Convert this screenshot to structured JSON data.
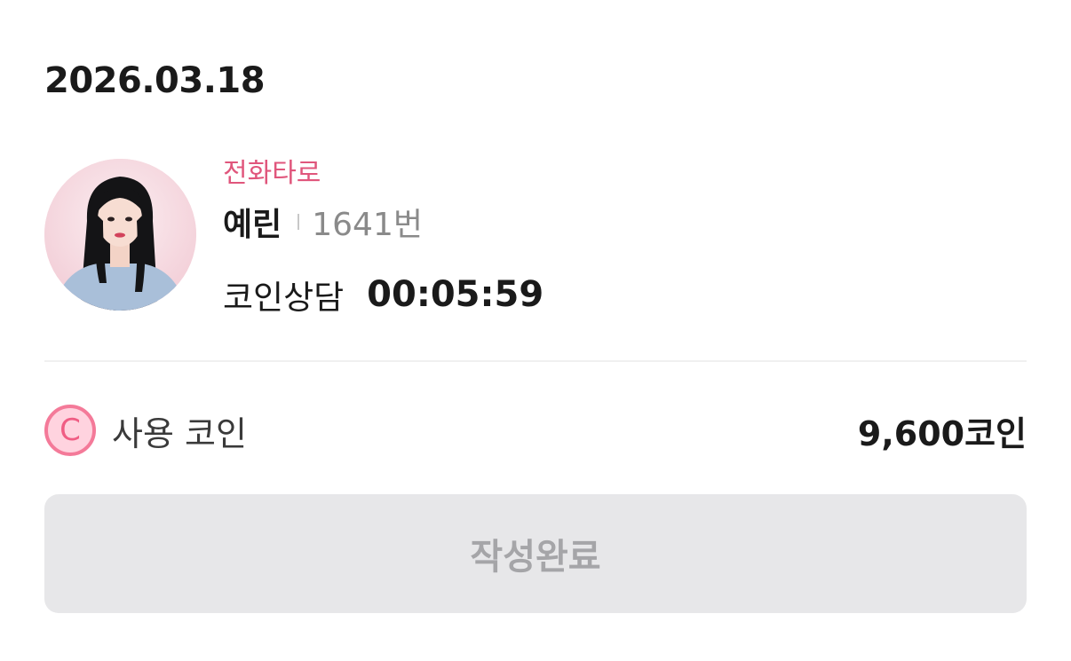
{
  "date": "2026.03.18",
  "counselor": {
    "category": "전화타로",
    "name": "예린",
    "number": "1641번"
  },
  "session": {
    "type": "코인상담",
    "duration": "00:05:59"
  },
  "coins": {
    "icon_glyph": "C",
    "label": "사용 코인",
    "amount": "9,600코인"
  },
  "submit_label": "작성완료",
  "colors": {
    "accent": "#e0567c",
    "coin_ring": "#f47a99",
    "button_bg": "#e7e7e9",
    "button_text": "#a5a5a8"
  }
}
